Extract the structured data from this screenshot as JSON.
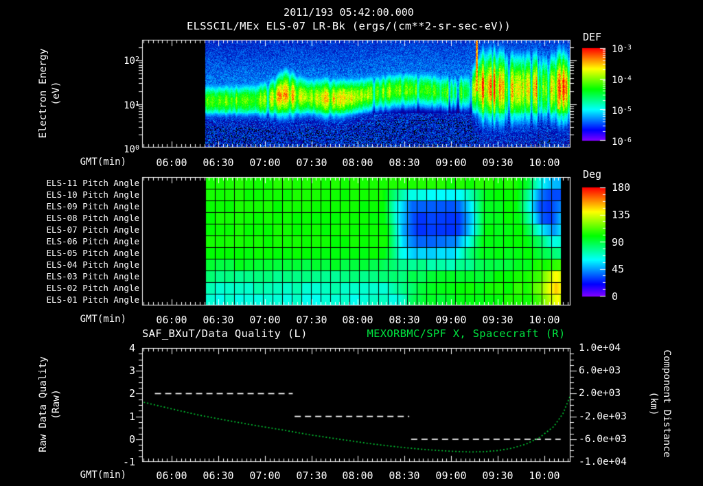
{
  "header": {
    "date_title": "2011/193 05:42:00.000",
    "plot_title": "ELSSCIL/MEx ELS-07 LR-Bk  (ergs/(cm**2-sr-sec-eV))"
  },
  "colors": {
    "background": "#000000",
    "text": "#ffffff",
    "accent_green": "#00e640",
    "curve_green": "#00c832",
    "quality_white": "#ffffff"
  },
  "time_axis": {
    "label": "GMT(min)",
    "ticks": [
      "06:00",
      "06:30",
      "07:00",
      "07:30",
      "08:00",
      "08:30",
      "09:00",
      "09:30",
      "10:00"
    ],
    "start": "05:42",
    "end": "10:17"
  },
  "spectrogram": {
    "colorbar_label": "DEF",
    "ylabel_line1": "Electron Energy",
    "ylabel_line2": "(eV)",
    "energy_ticks": [
      {
        "m": "10",
        "e": "2"
      },
      {
        "m": "10",
        "e": "1"
      },
      {
        "m": "10",
        "e": "0"
      }
    ],
    "colorbar_ticks": [
      {
        "m": "10",
        "e": "-3"
      },
      {
        "m": "10",
        "e": "-4"
      },
      {
        "m": "10",
        "e": "-5"
      },
      {
        "m": "10",
        "e": "-6"
      }
    ]
  },
  "pitch_panel": {
    "colorbar_label": "Deg",
    "colorbar_ticks": [
      "180",
      "135",
      "90",
      "45",
      "0"
    ],
    "row_labels": [
      "ELS-11 Pitch Angle",
      "ELS-10 Pitch Angle",
      "ELS-09 Pitch Angle",
      "ELS-08 Pitch Angle",
      "ELS-07 Pitch Angle",
      "ELS-06 Pitch Angle",
      "ELS-05 Pitch Angle",
      "ELS-04 Pitch Angle",
      "ELS-03 Pitch Angle",
      "ELS-02 Pitch Angle",
      "ELS-01 Pitch Angle"
    ]
  },
  "bottom_panel": {
    "left_title": "SAF_BXuT/Data Quality (L)",
    "right_title": "MEXORBMC/SPF X, Spacecraft (R)",
    "left_ylabel_line1": "Raw Data Quality",
    "left_ylabel_line2": "(Raw)",
    "right_ylabel_line1": "Component Distance",
    "right_ylabel_line2": "(km)",
    "left_yticks": [
      "4",
      "3",
      "2",
      "1",
      "0",
      "-1"
    ],
    "right_yticks": [
      "1.0e+04",
      "6.0e+03",
      "2.0e+03",
      "-2.0e+03",
      "-6.0e+03",
      "-1.0e+04"
    ]
  },
  "chart_data": [
    {
      "type": "heatmap",
      "name": "electron_energy_spectrogram",
      "x_unit": "GMT hours",
      "x_range": [
        5.683,
        10.285
      ],
      "data_time_range": [
        6.36,
        10.27
      ],
      "y_unit": "eV",
      "y_log10_range": [
        0,
        2.48
      ],
      "z_unit": "ergs/(cm**2-sr-sec-eV)",
      "z_log10_range": [
        -6,
        -3
      ],
      "band_keyframes": [
        [
          6.36,
          1.08,
          0.26,
          0.6
        ],
        [
          6.7,
          1.08,
          0.26,
          0.62
        ],
        [
          6.95,
          1.1,
          0.28,
          0.63
        ],
        [
          7.05,
          1.12,
          0.3,
          0.66
        ],
        [
          7.22,
          1.24,
          0.38,
          0.83
        ],
        [
          7.38,
          1.18,
          0.32,
          0.7
        ],
        [
          7.5,
          1.16,
          0.3,
          0.72
        ],
        [
          7.62,
          1.14,
          0.32,
          0.77
        ],
        [
          7.78,
          1.13,
          0.31,
          0.76
        ],
        [
          7.95,
          1.17,
          0.29,
          0.67
        ],
        [
          8.15,
          1.25,
          0.28,
          0.64
        ],
        [
          8.45,
          1.33,
          0.28,
          0.63
        ],
        [
          8.7,
          1.33,
          0.28,
          0.6
        ],
        [
          8.95,
          1.28,
          0.28,
          0.54
        ],
        [
          9.1,
          1.28,
          0.28,
          0.5
        ],
        [
          9.2,
          1.3,
          0.32,
          0.55
        ],
        [
          9.32,
          1.4,
          0.55,
          0.78
        ],
        [
          9.5,
          1.38,
          0.58,
          0.74
        ],
        [
          9.7,
          1.35,
          0.55,
          0.7
        ],
        [
          9.9,
          1.38,
          0.55,
          0.73
        ],
        [
          10.05,
          1.35,
          0.52,
          0.68
        ],
        [
          10.15,
          1.4,
          0.58,
          0.78
        ],
        [
          10.27,
          1.35,
          0.52,
          0.72
        ]
      ],
      "column_gap_times": [
        7.03,
        8.17,
        8.64,
        8.98,
        9.07,
        9.21,
        9.44,
        9.62,
        9.86,
        10.04
      ],
      "noise_amp_regions": [
        [
          5.68,
          8.8,
          0.12
        ],
        [
          8.8,
          9.2,
          0.3
        ],
        [
          9.2,
          10.29,
          0.25
        ]
      ],
      "streaks": [
        [
          9.27,
          1.3,
          2.48,
          0.95
        ],
        [
          10.15,
          0.9,
          1.8,
          0.88
        ]
      ]
    },
    {
      "type": "heatmap",
      "name": "pitch_angle_panel",
      "rows_top_to_bottom": [
        "ELS-11",
        "ELS-10",
        "ELS-09",
        "ELS-08",
        "ELS-07",
        "ELS-06",
        "ELS-05",
        "ELS-04",
        "ELS-03",
        "ELS-02",
        "ELS-01"
      ],
      "data_time_range": [
        6.36,
        10.18
      ],
      "value_unit": "deg",
      "value_range": [
        0,
        180
      ],
      "cell_noise_deg": [
        2,
        2,
        2,
        2,
        2,
        2,
        2,
        4,
        4,
        4,
        4
      ],
      "row_keyframes": [
        [
          [
            6.36,
            104
          ],
          [
            9.7,
            104
          ],
          [
            9.82,
            90
          ],
          [
            9.95,
            62
          ],
          [
            10.05,
            50
          ],
          [
            10.18,
            48
          ]
        ],
        [
          [
            6.36,
            103
          ],
          [
            8.25,
            102
          ],
          [
            8.4,
            80
          ],
          [
            8.55,
            62
          ],
          [
            9.1,
            60
          ],
          [
            9.25,
            78
          ],
          [
            9.38,
            98
          ],
          [
            9.7,
            100
          ],
          [
            9.82,
            75
          ],
          [
            9.95,
            40
          ],
          [
            10.05,
            32
          ],
          [
            10.18,
            33
          ]
        ],
        [
          [
            6.36,
            103
          ],
          [
            8.27,
            100
          ],
          [
            8.42,
            62
          ],
          [
            8.58,
            36
          ],
          [
            9.08,
            35
          ],
          [
            9.22,
            60
          ],
          [
            9.36,
            95
          ],
          [
            9.7,
            100
          ],
          [
            9.82,
            68
          ],
          [
            9.95,
            32
          ],
          [
            10.05,
            27
          ],
          [
            10.18,
            40
          ]
        ],
        [
          [
            6.36,
            102
          ],
          [
            8.28,
            100
          ],
          [
            8.45,
            52
          ],
          [
            8.6,
            30
          ],
          [
            9.08,
            30
          ],
          [
            9.22,
            55
          ],
          [
            9.36,
            95
          ],
          [
            9.72,
            100
          ],
          [
            9.85,
            70
          ],
          [
            9.97,
            35
          ],
          [
            10.07,
            30
          ],
          [
            10.18,
            52
          ]
        ],
        [
          [
            6.36,
            102
          ],
          [
            8.3,
            100
          ],
          [
            8.48,
            45
          ],
          [
            8.63,
            29
          ],
          [
            9.08,
            30
          ],
          [
            9.22,
            58
          ],
          [
            9.36,
            96
          ],
          [
            9.75,
            100
          ],
          [
            9.88,
            78
          ],
          [
            10.0,
            55
          ],
          [
            10.1,
            45
          ],
          [
            10.18,
            58
          ]
        ],
        [
          [
            6.36,
            102
          ],
          [
            8.3,
            101
          ],
          [
            8.48,
            52
          ],
          [
            8.65,
            36
          ],
          [
            9.05,
            40
          ],
          [
            9.2,
            68
          ],
          [
            9.35,
            98
          ],
          [
            9.8,
            100
          ],
          [
            9.95,
            85
          ],
          [
            10.08,
            65
          ],
          [
            10.18,
            68
          ]
        ],
        [
          [
            6.36,
            100
          ],
          [
            8.28,
            99
          ],
          [
            8.45,
            65
          ],
          [
            8.62,
            52
          ],
          [
            9.02,
            55
          ],
          [
            9.18,
            78
          ],
          [
            9.33,
            96
          ],
          [
            9.85,
            98
          ],
          [
            10.0,
            88
          ],
          [
            10.18,
            80
          ]
        ],
        [
          [
            6.36,
            94
          ],
          [
            8.2,
            90
          ],
          [
            8.4,
            78
          ],
          [
            9.1,
            74
          ],
          [
            9.28,
            84
          ],
          [
            9.55,
            92
          ],
          [
            9.9,
            100
          ],
          [
            10.05,
            108
          ],
          [
            10.18,
            113
          ]
        ],
        [
          [
            6.36,
            80
          ],
          [
            8.3,
            78
          ],
          [
            8.6,
            86
          ],
          [
            9.0,
            92
          ],
          [
            9.35,
            97
          ],
          [
            9.75,
            102
          ],
          [
            9.95,
            112
          ],
          [
            10.05,
            128
          ],
          [
            10.12,
            140
          ],
          [
            10.18,
            133
          ]
        ],
        [
          [
            6.36,
            70
          ],
          [
            8.35,
            70
          ],
          [
            8.6,
            88
          ],
          [
            9.0,
            97
          ],
          [
            9.4,
            100
          ],
          [
            9.8,
            105
          ],
          [
            9.95,
            116
          ],
          [
            10.05,
            134
          ],
          [
            10.12,
            150
          ],
          [
            10.18,
            140
          ]
        ],
        [
          [
            6.36,
            65
          ],
          [
            8.4,
            66
          ],
          [
            8.7,
            93
          ],
          [
            9.1,
            99
          ],
          [
            9.5,
            100
          ],
          [
            9.85,
            106
          ],
          [
            10.0,
            120
          ],
          [
            10.08,
            134
          ],
          [
            10.15,
            144
          ],
          [
            10.18,
            128
          ]
        ]
      ]
    },
    {
      "type": "line",
      "name": "quality_and_distance",
      "x_range": [
        5.683,
        10.285
      ],
      "left_axis": {
        "label": "Raw Data Quality (Raw)",
        "range": [
          -1,
          4
        ]
      },
      "right_axis": {
        "label": "Component Distance (km)",
        "range": [
          -10000,
          10000
        ]
      },
      "series": [
        {
          "name": "SAF_BXuT/Data Quality",
          "axis": "left",
          "color": "#ffffff",
          "style": "dashed",
          "segments": [
            [
              5.82,
              7.3,
              2
            ],
            [
              7.32,
              8.55,
              1
            ],
            [
              8.57,
              10.175,
              0
            ]
          ]
        },
        {
          "name": "MEXORBMC/SPF X Spacecraft",
          "axis": "right",
          "color": "#00c832",
          "style": "dotted",
          "t": [
            5.7,
            6.0,
            6.3,
            6.6,
            6.9,
            7.2,
            7.5,
            7.8,
            8.1,
            8.4,
            8.7,
            9.0,
            9.2,
            9.35,
            9.5,
            9.65,
            9.8,
            9.95,
            10.1,
            10.2,
            10.285
          ],
          "km": [
            480,
            -680,
            -1800,
            -2720,
            -3600,
            -4400,
            -5280,
            -6000,
            -6720,
            -7320,
            -7800,
            -8120,
            -8240,
            -8200,
            -8000,
            -7600,
            -6880,
            -5680,
            -3800,
            -1500,
            1900
          ]
        }
      ]
    }
  ]
}
